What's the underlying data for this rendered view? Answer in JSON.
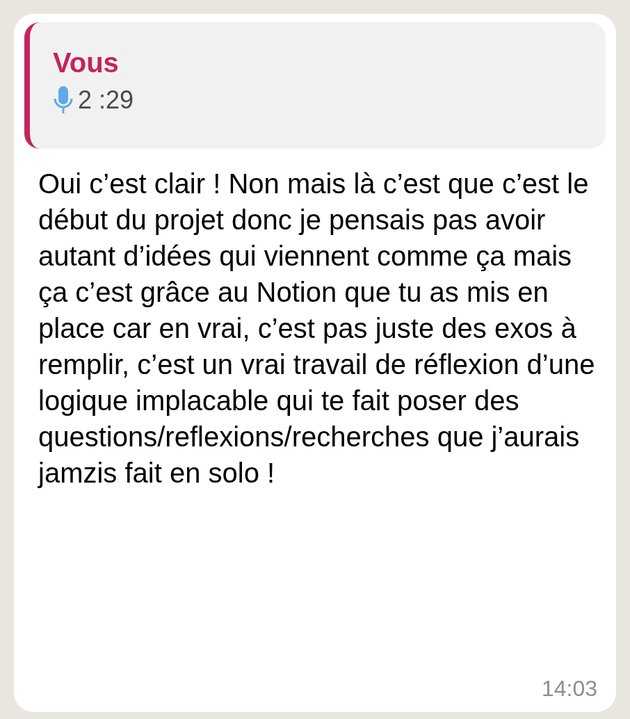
{
  "quoted_message": {
    "sender": "Vous",
    "kind": "voice",
    "duration": "2 :29"
  },
  "message": {
    "text": "Oui c’est clair ! Non mais là c’est que c’est le début du projet donc je pensais pas avoir autant d’idées qui viennent comme ça mais ça c’est grâce au Notion que tu as mis en place car en vrai, c’est pas juste des exos à remplir, c’est un vrai travail de réflexion d’une logique implacable qui te fait poser des questions/reflexions/recherches que j’aurais jamzis fait en solo !",
    "time": "14:03"
  }
}
